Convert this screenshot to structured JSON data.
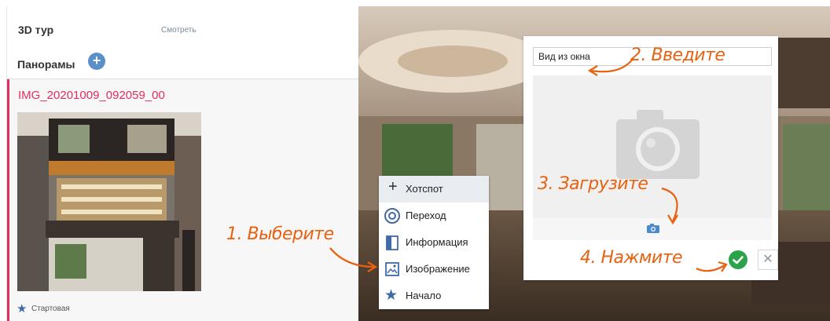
{
  "sidebar": {
    "tour_label": "3D тур",
    "view_link": "Смотреть",
    "panoramas_label": "Панорамы",
    "add_icon": "plus-circle-icon",
    "panorama": {
      "title": "IMG_20201009_092059_00",
      "start_label": "Стартовая",
      "start_icon": "star-icon"
    }
  },
  "menu": {
    "items": [
      {
        "label": "Хотспот",
        "icon": "plus-icon",
        "active": true
      },
      {
        "label": "Переход",
        "icon": "target-icon"
      },
      {
        "label": "Информация",
        "icon": "info-panel-icon"
      },
      {
        "label": "Изображение",
        "icon": "image-icon"
      },
      {
        "label": "Начало",
        "icon": "star-icon"
      }
    ]
  },
  "editor": {
    "name_value": "Вид из окна",
    "image_placeholder_icon": "camera-icon",
    "upload_icon": "camera-small-icon",
    "confirm_icon": "check-circle-icon",
    "cancel_icon": "close-icon"
  },
  "annotations": {
    "step1": "1. Выберите",
    "step2": "2. Введите",
    "step3": "3. Загрузите",
    "step4": "4. Нажмите"
  },
  "colors": {
    "accent_blue": "#5b8fc7",
    "active_red": "#e0305f",
    "annotation_orange": "#e8610e",
    "confirm_green": "#2aa34a"
  }
}
